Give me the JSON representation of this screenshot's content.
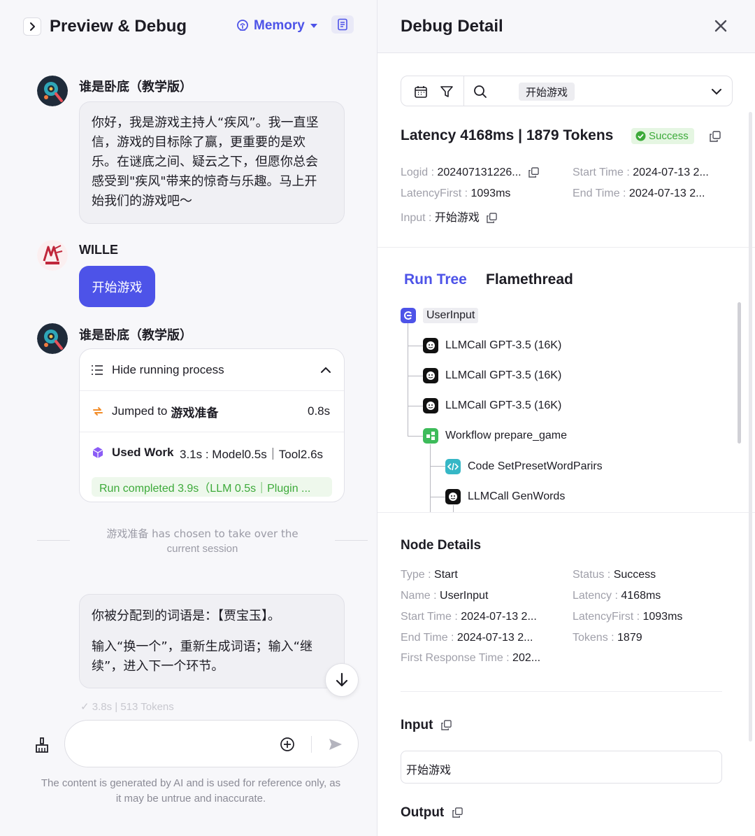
{
  "left": {
    "header": {
      "title": "Preview & Debug",
      "memory_label": "Memory"
    },
    "messages": [
      {
        "sender": "谁是卧底（教学版）",
        "lines": [
          "你好，我是游戏主持人“疾风”。我一直坚",
          "信，游戏的目标除了赢，更重要的是欢",
          "乐。在谜底之间、疑云之下，但愿你总会",
          "感受到\"疾风\"带来的惊奇与乐趣。马上开",
          "始我们的游戏吧～"
        ]
      },
      {
        "sender": "WILLE",
        "text": "开始游戏"
      },
      {
        "sender": "谁是卧底（教学版）"
      }
    ],
    "process": {
      "toggle_label": "Hide running process",
      "jump_prefix": "Jumped to",
      "jump_target": "游戏准备",
      "jump_time": "0.8s",
      "workflow_label": "Used Work",
      "workflow_stats": "3.1s : Model0.5s｜Tool2.6s",
      "run_complete": "Run completed 3.9s（LLM 0.5s｜Plugin ..."
    },
    "takeover": {
      "line1": "游戏准备 has chosen to take over the",
      "line2": "current session"
    },
    "reply": {
      "para1": "你被分配到的词语是：【贾宝玉】。",
      "para2_line1": "输入“换一个”，重新生成词语；输入“继",
      "para2_line2": "续”，进入下一个环节。"
    },
    "msg_meta": "✓ 3.8s  |  513 Tokens",
    "disclaimer_line1": "The content is generated by AI and is used for reference only, as",
    "disclaimer_line2": "it may be untrue and inaccurate."
  },
  "right": {
    "title": "Debug Detail",
    "search_tag": "开始游戏",
    "summary": {
      "latency_tokens": "Latency 4168ms | 1879 Tokens",
      "status": "Success",
      "logid_k": "Logid : ",
      "logid_v": "202407131226...",
      "start_k": "Start Time : ",
      "start_v": "2024-07-13 2...",
      "lfirst_k": "LatencyFirst : ",
      "lfirst_v": "1093ms",
      "end_k": "End Time : ",
      "end_v": "2024-07-13 2...",
      "input_k": "Input : ",
      "input_v": "开始游戏"
    },
    "tabs": {
      "run_tree": "Run Tree",
      "flamethread": "Flamethread"
    },
    "tree": [
      {
        "label": "UserInput"
      },
      {
        "label": "LLMCall GPT-3.5 (16K)"
      },
      {
        "label": "LLMCall GPT-3.5 (16K)"
      },
      {
        "label": "LLMCall GPT-3.5 (16K)"
      },
      {
        "label": "Workflow prepare_game"
      },
      {
        "label": "Code SetPresetWordParirs"
      },
      {
        "label": "LLMCall GenWords"
      }
    ],
    "node_details": {
      "title": "Node Details",
      "type_k": "Type : ",
      "type_v": "Start",
      "status_k": "Status : ",
      "status_v": "Success",
      "name_k": "Name : ",
      "name_v": "UserInput",
      "latency_k": "Latency : ",
      "latency_v": "4168ms",
      "start_k": "Start Time : ",
      "start_v": "2024-07-13 2...",
      "lfirst_k": "LatencyFirst : ",
      "lfirst_v": "1093ms",
      "end_k": "End Time : ",
      "end_v": "2024-07-13 2...",
      "tokens_k": "Tokens : ",
      "tokens_v": "1879",
      "frt_k": "First Response Time : ",
      "frt_v": "202..."
    },
    "input_title": "Input",
    "input_value": "开始游戏",
    "output_title": "Output"
  },
  "colors": {
    "accent": "#4d53e8",
    "success": "#3daa3a"
  }
}
